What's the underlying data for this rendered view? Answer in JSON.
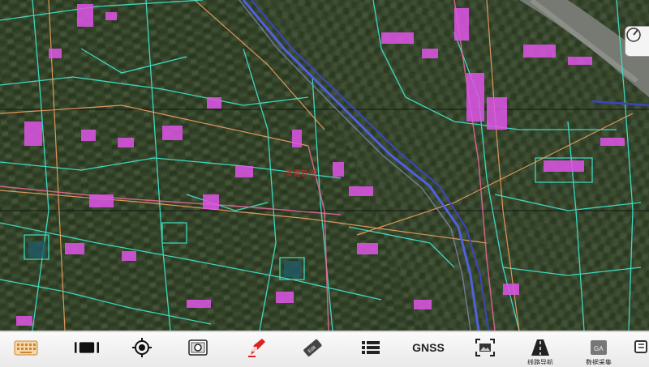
{
  "map": {
    "overlay_label": "高速铁路",
    "colors": {
      "land": "#3a4a2c",
      "field_dark": "#2c3a22",
      "parcel_line": "#3fe0c8",
      "building": "#e055e8",
      "road": "#f0a060",
      "rail": "#5060e0",
      "river": "#6a6e68",
      "gridline": "#151515"
    }
  },
  "toolbar": {
    "items": [
      {
        "name": "keyboard",
        "icon": "keyboard-icon",
        "label": ""
      },
      {
        "name": "full-extent",
        "icon": "full-extent-icon",
        "label": ""
      },
      {
        "name": "locate",
        "icon": "crosshair-icon",
        "label": ""
      },
      {
        "name": "snapshot",
        "icon": "camera-icon",
        "label": ""
      },
      {
        "name": "draw",
        "icon": "pen-icon",
        "label": ""
      },
      {
        "name": "edit",
        "icon": "edit-tag-icon",
        "label": ""
      },
      {
        "name": "layers",
        "icon": "layer-list-icon",
        "label": ""
      },
      {
        "name": "gnss",
        "icon": "gnss-text-icon",
        "label": "GNSS"
      },
      {
        "name": "screen-capture",
        "icon": "screen-capture-icon",
        "label": ""
      },
      {
        "name": "navigation",
        "icon": "road-icon",
        "label": "线路导航"
      },
      {
        "name": "data-collect",
        "icon": "data-box-icon",
        "label": "数据采集"
      },
      {
        "name": "more",
        "icon": "more-icon",
        "label": ""
      }
    ]
  }
}
